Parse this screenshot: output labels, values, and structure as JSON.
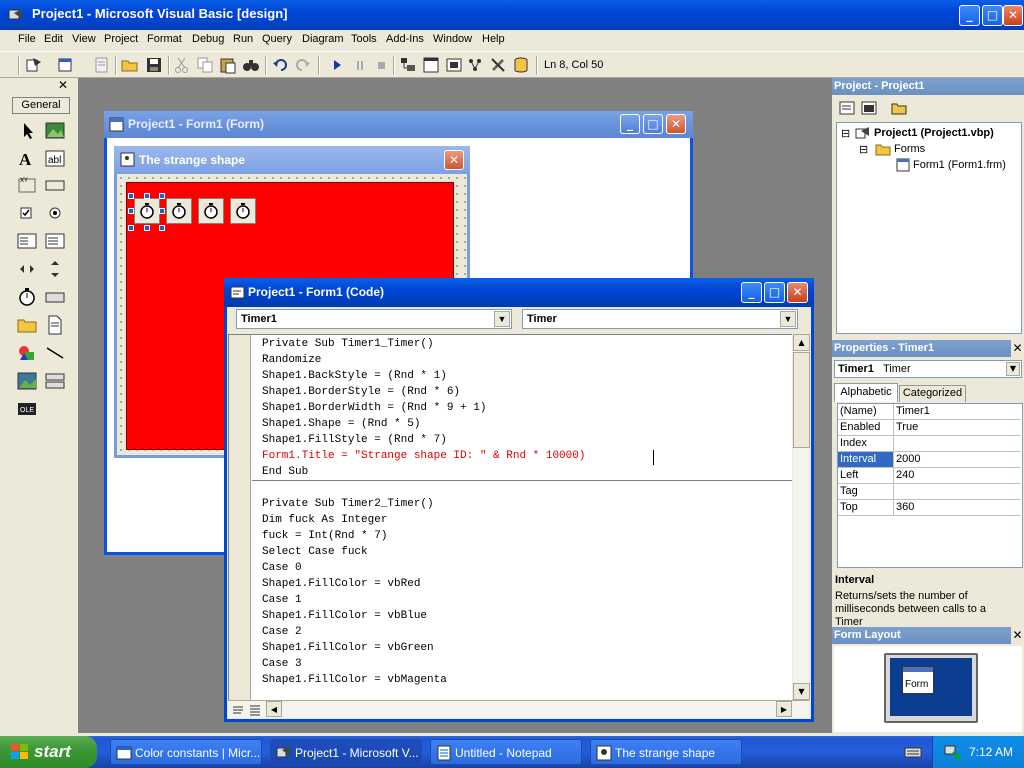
{
  "app": {
    "title": "Project1 - Microsoft Visual Basic [design]"
  },
  "menu": [
    "File",
    "Edit",
    "View",
    "Project",
    "Format",
    "Debug",
    "Run",
    "Query",
    "Diagram",
    "Tools",
    "Add-Ins",
    "Window",
    "Help"
  ],
  "toolbar": {
    "status": "Ln 8, Col 50"
  },
  "toolbox": {
    "tab": "General"
  },
  "form_designer": {
    "title": "Project1 - Form1 (Form)",
    "inner_title": "The strange shape"
  },
  "code_window": {
    "title": "Project1 - Form1 (Code)",
    "object_combo": "Timer1",
    "proc_combo": "Timer",
    "lines": [
      {
        "text": "Private Sub Timer1_Timer()",
        "color": "black"
      },
      {
        "text": "Randomize",
        "color": "black"
      },
      {
        "text": "Shape1.BackStyle = (Rnd * 1)",
        "color": "black"
      },
      {
        "text": "Shape1.BorderStyle = (Rnd * 6)",
        "color": "black"
      },
      {
        "text": "Shape1.BorderWidth = (Rnd * 9 + 1)",
        "color": "black"
      },
      {
        "text": "Shape1.Shape = (Rnd * 5)",
        "color": "black"
      },
      {
        "text": "Shape1.FillStyle = (Rnd * 7)",
        "color": "black"
      },
      {
        "text": "Form1.Title = \"Strange shape ID: \" & Rnd * 10000)",
        "color": "red"
      },
      {
        "text": "End Sub",
        "color": "black"
      },
      {
        "text": "",
        "color": "black"
      },
      {
        "text": "Private Sub Timer2_Timer()",
        "color": "black"
      },
      {
        "text": "Dim fuck As Integer",
        "color": "black"
      },
      {
        "text": "fuck = Int(Rnd * 7)",
        "color": "black"
      },
      {
        "text": "Select Case fuck",
        "color": "black"
      },
      {
        "text": "Case 0",
        "color": "black"
      },
      {
        "text": "Shape1.FillColor = vbRed",
        "color": "black"
      },
      {
        "text": "Case 1",
        "color": "black"
      },
      {
        "text": "Shape1.FillColor = vbBlue",
        "color": "black"
      },
      {
        "text": "Case 2",
        "color": "black"
      },
      {
        "text": "Shape1.FillColor = vbGreen",
        "color": "black"
      },
      {
        "text": "Case 3",
        "color": "black"
      },
      {
        "text": "Shape1.FillColor = vbMagenta",
        "color": "black"
      }
    ]
  },
  "project_panel": {
    "title": "Project - Project1",
    "root": "Project1 (Project1.vbp)",
    "folder": "Forms",
    "item": "Form1 (Form1.frm)"
  },
  "properties_panel": {
    "title": "Properties - Timer1",
    "object_name": "Timer1",
    "object_type": "Timer",
    "tab_alpha": "Alphabetic",
    "tab_cat": "Categorized",
    "rows": [
      {
        "name": "(Name)",
        "value": "Timer1"
      },
      {
        "name": "Enabled",
        "value": "True"
      },
      {
        "name": "Index",
        "value": ""
      },
      {
        "name": "Interval",
        "value": "2000"
      },
      {
        "name": "Left",
        "value": "240"
      },
      {
        "name": "Tag",
        "value": ""
      },
      {
        "name": "Top",
        "value": "360"
      }
    ],
    "selected_row": "Interval",
    "desc_title": "Interval",
    "desc_text": "Returns/sets the number of milliseconds between calls to a Timer"
  },
  "form_layout": {
    "title": "Form Layout",
    "preview_label": "Form"
  },
  "taskbar": {
    "start": "start",
    "tasks": [
      "Color constants | Micr...",
      "Project1 - Microsoft V...",
      "Untitled - Notepad",
      "The strange shape"
    ],
    "active_task": "Project1 - Microsoft V...",
    "clock": "7:12 AM"
  },
  "colors": {
    "xp_title_blue": "#0046d5",
    "shape_fill": "#ff0000",
    "code_error": "#e00000",
    "selected_prop": "#316ac5"
  }
}
